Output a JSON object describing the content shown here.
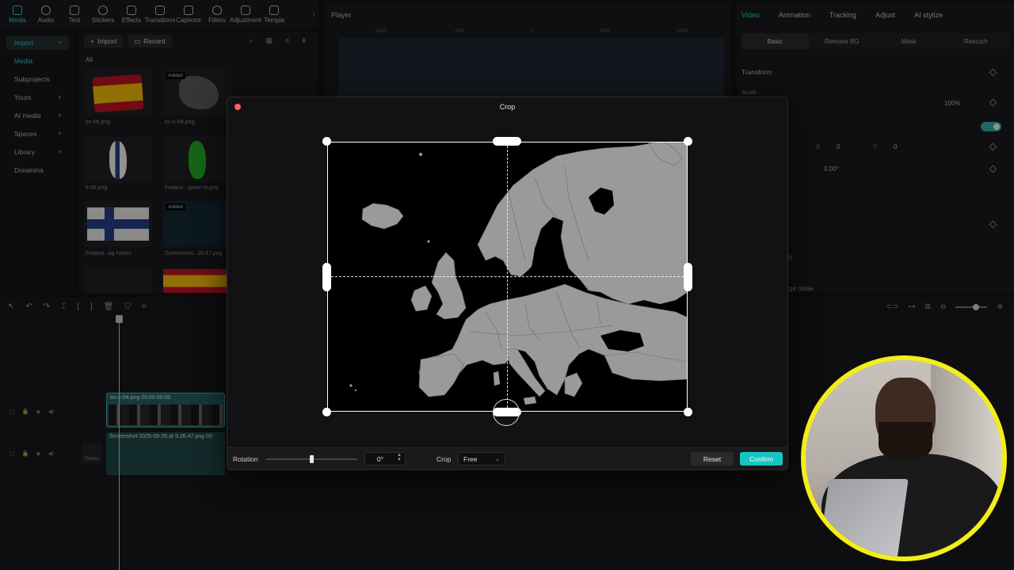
{
  "app": {
    "tool_tabs": [
      {
        "label": "Media",
        "icon": "media-icon",
        "active": true
      },
      {
        "label": "Audio",
        "icon": "audio-icon"
      },
      {
        "label": "Text",
        "icon": "text-icon"
      },
      {
        "label": "Stickers",
        "icon": "stickers-icon"
      },
      {
        "label": "Effects",
        "icon": "effects-icon"
      },
      {
        "label": "Transitions",
        "icon": "transitions-icon"
      },
      {
        "label": "Captions",
        "icon": "captions-icon"
      },
      {
        "label": "Filters",
        "icon": "filters-icon"
      },
      {
        "label": "Adjustment",
        "icon": "adjustment-icon"
      },
      {
        "label": "Templa",
        "icon": "templates-icon"
      }
    ],
    "left_nav": [
      {
        "label": "Import",
        "chevron": true,
        "selected": true
      },
      {
        "label": "Media"
      },
      {
        "label": "Subprojects"
      },
      {
        "label": "Yours",
        "chevron": true
      },
      {
        "label": "AI media",
        "chevron": true
      },
      {
        "label": "Spaces",
        "chevron": true
      },
      {
        "label": "Library",
        "chevron": true
      },
      {
        "label": "Dreamina"
      }
    ],
    "media": {
      "import_label": "Import",
      "record_label": "Record",
      "all_label": "All",
      "thumbs": [
        {
          "caption": "es-06.png",
          "added": ""
        },
        {
          "caption": "eu-c-04.png",
          "added": "Added"
        },
        {
          "caption": "fi-06.png",
          "added": ""
        },
        {
          "caption": "Finland - green fil.png",
          "added": ""
        },
        {
          "caption": "Finland...ag fumes",
          "added": ""
        },
        {
          "caption": "Screenshot...26.47.png",
          "added": "Added"
        }
      ]
    },
    "player": {
      "title": "Player",
      "ruler": [
        "-1000",
        "-500",
        "0",
        "500",
        "1000"
      ]
    },
    "right": {
      "tabs": [
        "Video",
        "Animation",
        "Tracking",
        "Adjust",
        "AI stylize"
      ],
      "subtabs": [
        "Basic",
        "Remove BG",
        "Mask",
        "Retouch"
      ],
      "transform_label": "Transform",
      "scale_label": "Scale",
      "scale_value": "100%",
      "pos_x_label": "X",
      "pos_x": "0",
      "pos_y_label": "Y",
      "pos_y": "0",
      "rotate_value": "0.00°",
      "quality_label": "ality",
      "noise_label": "ge noise"
    },
    "timeline": {
      "clip1_label": "eu-c-04.png  00:00:00:00",
      "clip2_label": "Screenshot 2025-09-26 at 9.26.47.png  00:",
      "cover_label": "Cover"
    }
  },
  "crop_dialog": {
    "title": "Crop",
    "rotation_label": "Rotation",
    "rotation_value": "0°",
    "crop_label": "Crop",
    "crop_mode": "Free",
    "reset_label": "Reset",
    "confirm_label": "Confirm",
    "accent": "#17c5c0",
    "rotation_fraction": 0.5
  },
  "colors": {
    "accent": "#2fd3d0",
    "map_land": "#9a9a9a",
    "webcam_ring": "#f2ee1a",
    "close": "#ff5f57"
  }
}
